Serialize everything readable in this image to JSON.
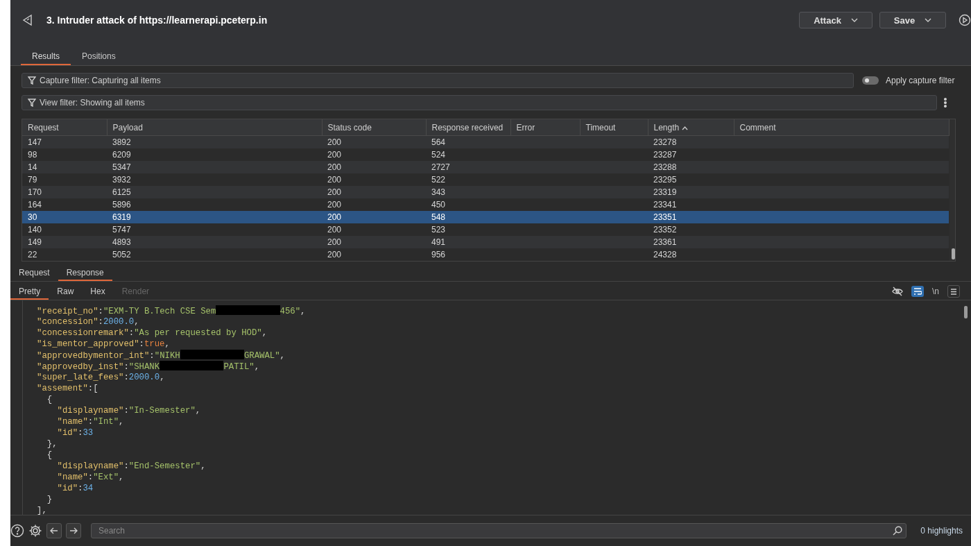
{
  "header": {
    "title": "3. Intruder attack of https://learnerapi.pceterp.in",
    "buttons": [
      {
        "label": "Attack"
      },
      {
        "label": "Save"
      }
    ]
  },
  "tabs": [
    {
      "label": "Results",
      "selected": true
    },
    {
      "label": "Positions",
      "selected": false
    }
  ],
  "capture_filter": {
    "text": "Capture filter: Capturing all items"
  },
  "apply_capture_filter": {
    "label": "Apply capture filter",
    "on": false
  },
  "view_filter": {
    "text": "View filter: Showing all items"
  },
  "table": {
    "columns": [
      {
        "label": "Request",
        "sorted": false
      },
      {
        "label": "Payload",
        "sorted": false
      },
      {
        "label": "Status code",
        "sorted": false
      },
      {
        "label": "Response received",
        "sorted": false
      },
      {
        "label": "Error",
        "sorted": false
      },
      {
        "label": "Timeout",
        "sorted": false
      },
      {
        "label": "Length",
        "sorted": true
      },
      {
        "label": "Comment",
        "sorted": false
      }
    ],
    "rows": [
      {
        "cells": [
          "147",
          "3892",
          "200",
          "564",
          "23278"
        ],
        "selected": false
      },
      {
        "cells": [
          "98",
          "6209",
          "200",
          "524",
          "23287"
        ],
        "selected": false
      },
      {
        "cells": [
          "14",
          "5347",
          "200",
          "2727",
          "23288"
        ],
        "selected": false
      },
      {
        "cells": [
          "79",
          "3932",
          "200",
          "522",
          "23295"
        ],
        "selected": false
      },
      {
        "cells": [
          "170",
          "6125",
          "200",
          "343",
          "23319"
        ],
        "selected": false
      },
      {
        "cells": [
          "164",
          "5896",
          "200",
          "450",
          "23341"
        ],
        "selected": false
      },
      {
        "cells": [
          "30",
          "6319",
          "200",
          "548",
          "23351"
        ],
        "selected": true
      },
      {
        "cells": [
          "140",
          "5747",
          "200",
          "523",
          "23352"
        ],
        "selected": false
      },
      {
        "cells": [
          "149",
          "4893",
          "200",
          "491",
          "23361"
        ],
        "selected": false
      },
      {
        "cells": [
          "22",
          "5052",
          "200",
          "956",
          "24328"
        ],
        "selected": false
      }
    ]
  },
  "message_tabs": [
    {
      "label": "Request",
      "selected": false
    },
    {
      "label": "Response",
      "selected": true
    }
  ],
  "view_tabs": [
    {
      "label": "Pretty",
      "selected": true,
      "disabled": false
    },
    {
      "label": "Raw",
      "selected": false,
      "disabled": false
    },
    {
      "label": "Hex",
      "selected": false,
      "disabled": false
    },
    {
      "label": "Render",
      "selected": false,
      "disabled": true
    }
  ],
  "toolbar": {
    "wrap_on": true,
    "newline_label": "\\n"
  },
  "code_lines": [
    [
      {
        "kind": "key",
        "text": "\"receipt_no\""
      },
      {
        "kind": "punct",
        "text": ":"
      },
      {
        "kind": "string",
        "text": "\"EXM-TY B.Tech CSE Sem"
      },
      {
        "kind": "redacted"
      },
      {
        "kind": "string",
        "text": "456\""
      },
      {
        "kind": "punct",
        "text": ","
      }
    ],
    [
      {
        "kind": "key",
        "text": "\"concession\""
      },
      {
        "kind": "punct",
        "text": ":"
      },
      {
        "kind": "number",
        "text": "2000.0"
      },
      {
        "kind": "punct",
        "text": ","
      }
    ],
    [
      {
        "kind": "key",
        "text": "\"concessionremark\""
      },
      {
        "kind": "punct",
        "text": ":"
      },
      {
        "kind": "string",
        "text": "\"As per requested by HOD\""
      },
      {
        "kind": "punct",
        "text": ","
      }
    ],
    [
      {
        "kind": "key",
        "text": "\"is_mentor_approved\""
      },
      {
        "kind": "punct",
        "text": ":"
      },
      {
        "kind": "bool",
        "text": "true"
      },
      {
        "kind": "punct",
        "text": ","
      }
    ],
    [
      {
        "kind": "key",
        "text": "\"approvedbymentor_int\""
      },
      {
        "kind": "punct",
        "text": ":"
      },
      {
        "kind": "string",
        "text": "\"NIKH"
      },
      {
        "kind": "redacted"
      },
      {
        "kind": "string",
        "text": "GRAWAL\""
      },
      {
        "kind": "punct",
        "text": ","
      }
    ],
    [
      {
        "kind": "key",
        "text": "\"approvedby_inst\""
      },
      {
        "kind": "punct",
        "text": ":"
      },
      {
        "kind": "string",
        "text": "\"SHANK"
      },
      {
        "kind": "redacted"
      },
      {
        "kind": "string",
        "text": "PATIL\""
      },
      {
        "kind": "punct",
        "text": ","
      }
    ],
    [
      {
        "kind": "key",
        "text": "\"super_late_fees\""
      },
      {
        "kind": "punct",
        "text": ":"
      },
      {
        "kind": "number",
        "text": "2000.0"
      },
      {
        "kind": "punct",
        "text": ","
      }
    ],
    [
      {
        "kind": "key",
        "text": "\"assement\""
      },
      {
        "kind": "punct",
        "text": ":["
      }
    ],
    [
      {
        "kind": "punct",
        "text": "  {"
      }
    ],
    [
      {
        "kind": "key",
        "text": "    \"displayname\""
      },
      {
        "kind": "punct",
        "text": ":"
      },
      {
        "kind": "string",
        "text": "\"In-Semester\""
      },
      {
        "kind": "punct",
        "text": ","
      }
    ],
    [
      {
        "kind": "key",
        "text": "    \"name\""
      },
      {
        "kind": "punct",
        "text": ":"
      },
      {
        "kind": "string",
        "text": "\"Int\""
      },
      {
        "kind": "punct",
        "text": ","
      }
    ],
    [
      {
        "kind": "key",
        "text": "    \"id\""
      },
      {
        "kind": "punct",
        "text": ":"
      },
      {
        "kind": "number",
        "text": "33"
      }
    ],
    [
      {
        "kind": "punct",
        "text": "  },"
      }
    ],
    [
      {
        "kind": "punct",
        "text": "  {"
      }
    ],
    [
      {
        "kind": "key",
        "text": "    \"displayname\""
      },
      {
        "kind": "punct",
        "text": ":"
      },
      {
        "kind": "string",
        "text": "\"End-Semester\""
      },
      {
        "kind": "punct",
        "text": ","
      }
    ],
    [
      {
        "kind": "key",
        "text": "    \"name\""
      },
      {
        "kind": "punct",
        "text": ":"
      },
      {
        "kind": "string",
        "text": "\"Ext\""
      },
      {
        "kind": "punct",
        "text": ","
      }
    ],
    [
      {
        "kind": "key",
        "text": "    \"id\""
      },
      {
        "kind": "punct",
        "text": ":"
      },
      {
        "kind": "number",
        "text": "34"
      }
    ],
    [
      {
        "kind": "punct",
        "text": "  }"
      }
    ],
    [
      {
        "kind": "punct",
        "text": "],"
      }
    ]
  ],
  "footer": {
    "search_placeholder": "Search",
    "highlights": "0 highlights"
  }
}
